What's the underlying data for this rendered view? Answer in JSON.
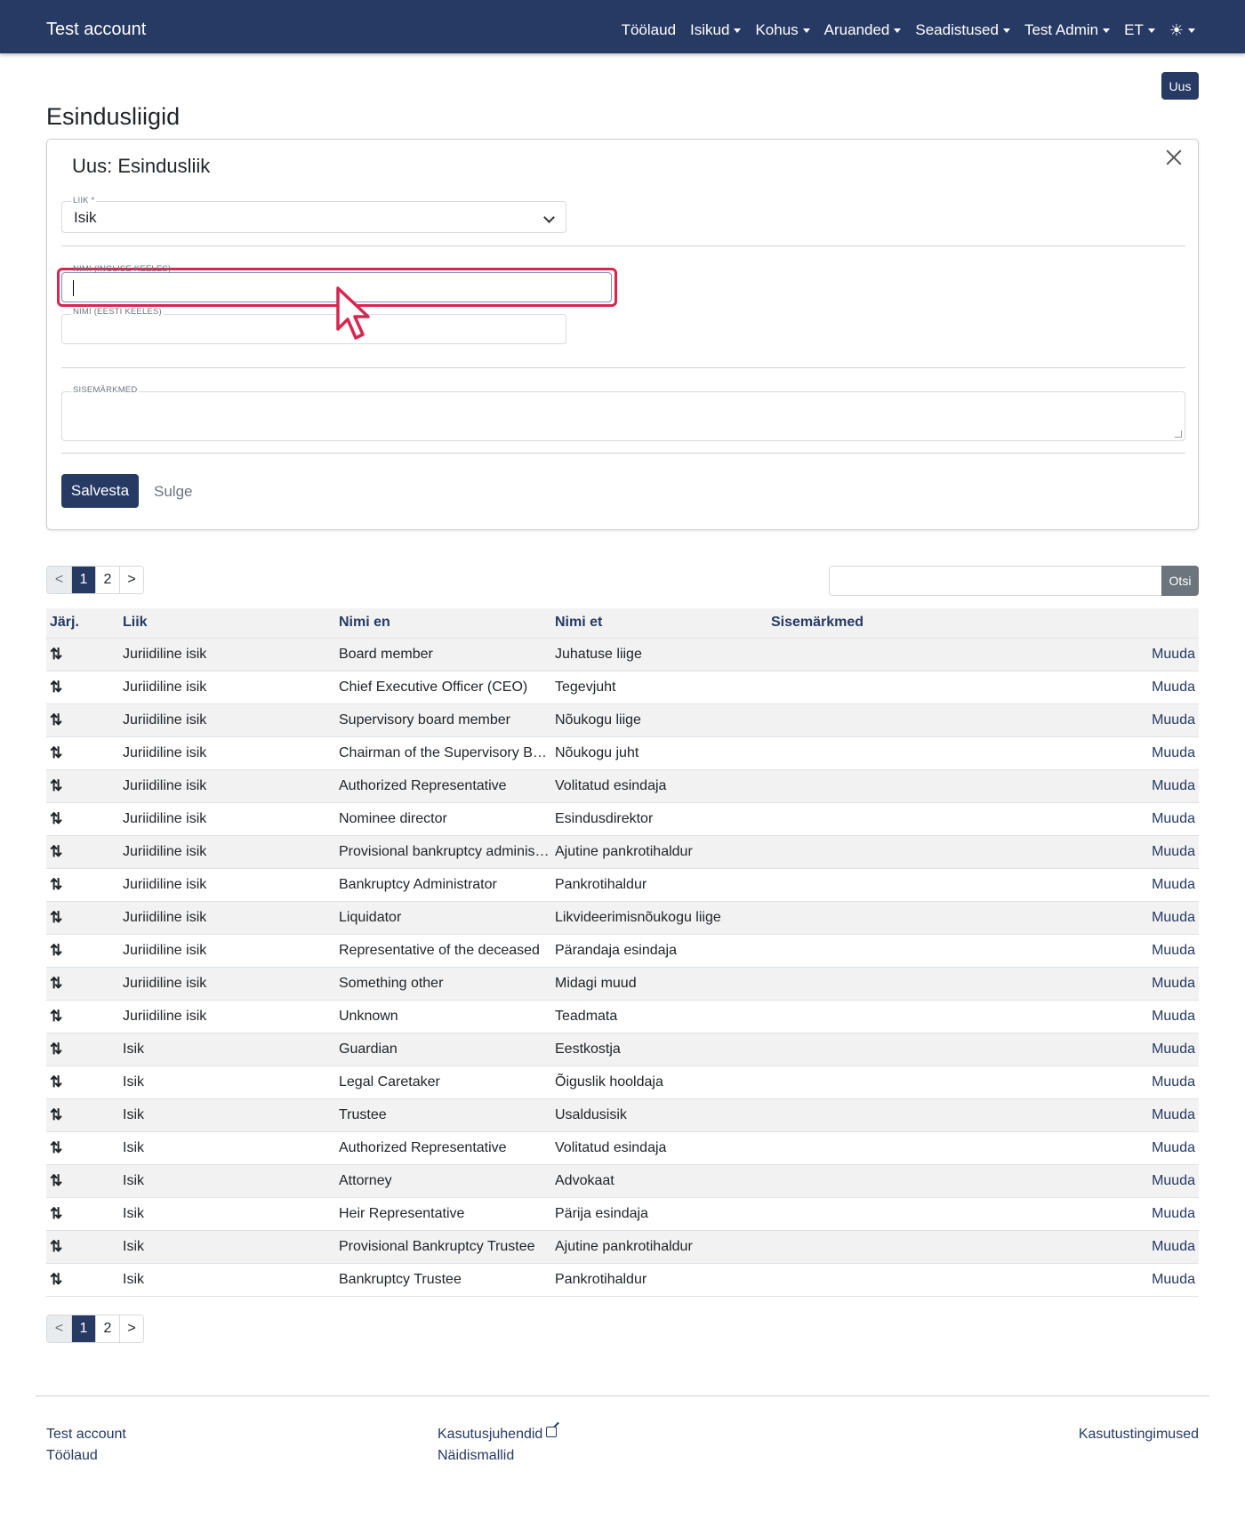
{
  "navbar": {
    "brand": "Test account",
    "items": [
      {
        "label": "Töölaud",
        "dropdown": false
      },
      {
        "label": "Isikud",
        "dropdown": true
      },
      {
        "label": "Kohus",
        "dropdown": true
      },
      {
        "label": "Aruanded",
        "dropdown": true
      },
      {
        "label": "Seadistused",
        "dropdown": true
      },
      {
        "label": "Test Admin",
        "dropdown": true
      },
      {
        "label": "ET",
        "dropdown": true
      }
    ],
    "theme_icon": "☀"
  },
  "page": {
    "new_button": "Uus",
    "title": "Esindusliigid"
  },
  "form": {
    "title": "Uus: Esindusliik",
    "type_label": "LIIK *",
    "type_value": "Isik",
    "name_en_label": "NIMI (INGLISE KEELES)",
    "name_en_value": "",
    "name_et_label": "NIMI (EESTI KEELES)",
    "name_et_value": "",
    "notes_label": "SISEMÄRKMED",
    "notes_value": "",
    "save_label": "Salvesta",
    "close_label": "Sulge"
  },
  "pagination": {
    "prev": "<",
    "pages": [
      "1",
      "2"
    ],
    "current": "1",
    "next": ">"
  },
  "search": {
    "placeholder": "",
    "button": "Otsi"
  },
  "table": {
    "headers": [
      "Järj.",
      "Liik",
      "Nimi en",
      "Nimi et",
      "Sisemärkmed"
    ],
    "sort_icon": "⇅",
    "action_label": "Muuda",
    "rows": [
      {
        "type": "Juriidiline isik",
        "name_en": "Board member",
        "name_et": "Juhatuse liige",
        "notes": ""
      },
      {
        "type": "Juriidiline isik",
        "name_en": "Chief Executive Officer (CEO)",
        "name_et": "Tegevjuht",
        "notes": ""
      },
      {
        "type": "Juriidiline isik",
        "name_en": "Supervisory board member",
        "name_et": "Nõukogu liige",
        "notes": ""
      },
      {
        "type": "Juriidiline isik",
        "name_en": "Chairman of the Supervisory Board",
        "name_et": "Nõukogu juht",
        "notes": ""
      },
      {
        "type": "Juriidiline isik",
        "name_en": "Authorized Representative",
        "name_et": "Volitatud esindaja",
        "notes": ""
      },
      {
        "type": "Juriidiline isik",
        "name_en": "Nominee director",
        "name_et": "Esindusdirektor",
        "notes": ""
      },
      {
        "type": "Juriidiline isik",
        "name_en": "Provisional bankruptcy administrator",
        "name_et": "Ajutine pankrotihaldur",
        "notes": ""
      },
      {
        "type": "Juriidiline isik",
        "name_en": "Bankruptcy Administrator",
        "name_et": "Pankrotihaldur",
        "notes": ""
      },
      {
        "type": "Juriidiline isik",
        "name_en": "Liquidator",
        "name_et": "Likvideerimisnõukogu liige",
        "notes": ""
      },
      {
        "type": "Juriidiline isik",
        "name_en": "Representative of the deceased",
        "name_et": "Pärandaja esindaja",
        "notes": ""
      },
      {
        "type": "Juriidiline isik",
        "name_en": "Something other",
        "name_et": "Midagi muud",
        "notes": ""
      },
      {
        "type": "Juriidiline isik",
        "name_en": "Unknown",
        "name_et": "Teadmata",
        "notes": ""
      },
      {
        "type": "Isik",
        "name_en": "Guardian",
        "name_et": "Eestkostja",
        "notes": ""
      },
      {
        "type": "Isik",
        "name_en": "Legal Caretaker",
        "name_et": "Õiguslik hooldaja",
        "notes": ""
      },
      {
        "type": "Isik",
        "name_en": "Trustee",
        "name_et": "Usaldusisik",
        "notes": ""
      },
      {
        "type": "Isik",
        "name_en": "Authorized Representative",
        "name_et": "Volitatud esindaja",
        "notes": ""
      },
      {
        "type": "Isik",
        "name_en": "Attorney",
        "name_et": "Advokaat",
        "notes": ""
      },
      {
        "type": "Isik",
        "name_en": "Heir Representative",
        "name_et": "Pärija esindaja",
        "notes": ""
      },
      {
        "type": "Isik",
        "name_en": "Provisional Bankruptcy Trustee",
        "name_et": "Ajutine pankrotihaldur",
        "notes": ""
      },
      {
        "type": "Isik",
        "name_en": "Bankruptcy Trustee",
        "name_et": "Pankrotihaldur",
        "notes": ""
      }
    ]
  },
  "footer": {
    "col1": [
      "Test account",
      "Töölaud"
    ],
    "col2": [
      "Kasutusjuhendid",
      "Näidismallid"
    ],
    "col3": [
      "Kasutustingimused"
    ]
  },
  "colors": {
    "primary": "#263a63",
    "highlight": "#d7264f"
  }
}
